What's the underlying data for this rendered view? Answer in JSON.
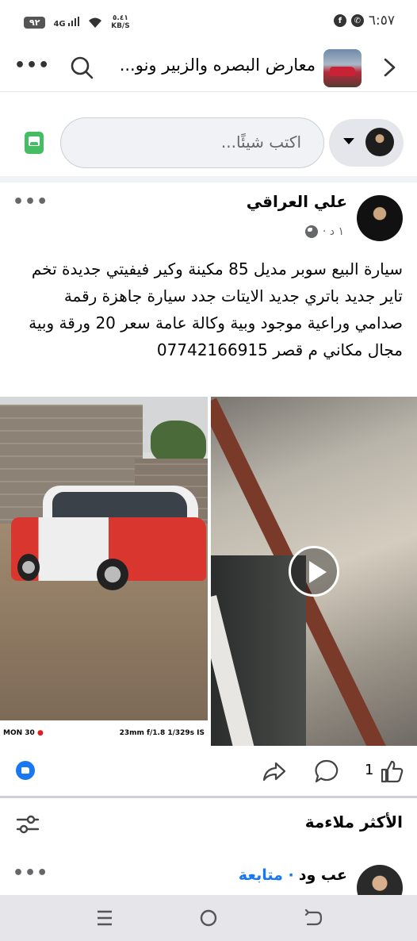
{
  "status_bar": {
    "time": "٦:٥٧",
    "battery": "٩٢",
    "network": "4G",
    "speed_value": "٥.٤١",
    "speed_unit": "KB/S",
    "left_icons": [
      "facebook-icon",
      "whatsapp-icon"
    ]
  },
  "header": {
    "group_title": "معارض البصره والزبير ونو..."
  },
  "composer": {
    "placeholder": "اكتب شيئًا..."
  },
  "post": {
    "author": "علي العراقي",
    "time": "١ د ·",
    "text": "سيارة البيع سوبر مديل 85 مكينة وكير فيفيتي جديدة تخم تاير جديد باتري جديد الايتات جدد سيارة جاهزة رقمة صدامي وراعية موجود وبية وكالة عامة سعر 20 ورقة وبية مجال مكاني م قصر 07742166915",
    "photo_caption_left": "MON 30",
    "photo_caption_right": "23mm f/1.8 1/329s IS",
    "like_count": "1"
  },
  "comments": {
    "sort_label": "الأكثر ملاءمة",
    "first_author": "عب ود",
    "follow_label": "· متابعة"
  },
  "colors": {
    "accent": "#1877f2",
    "composer_bg": "#f0f2f5"
  }
}
